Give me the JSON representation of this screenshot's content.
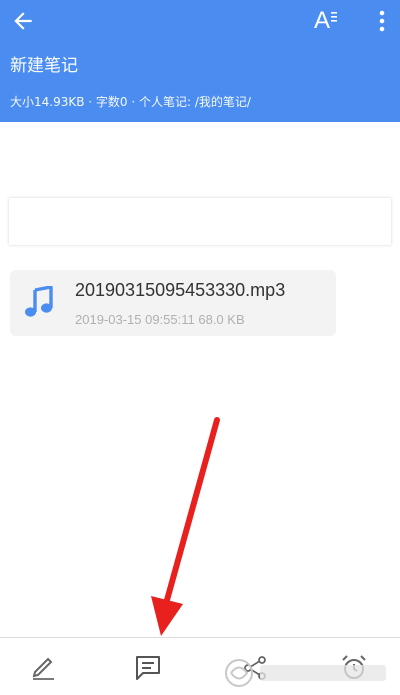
{
  "header": {
    "title": "新建笔记",
    "meta": "大小14.93KB · 字数0 · 个人笔记: /我的笔记/",
    "font_glyph": "A",
    "back_icon": "arrow-left-icon",
    "more_icon": "more-vertical-icon"
  },
  "attachment": {
    "filename": "20190315095453330.mp3",
    "info": "2019-03-15 09:55:11   68.0 KB",
    "icon": "music-note-icon",
    "icon_color": "#4a8cf0"
  },
  "bottom_bar": {
    "icons": [
      "pencil-icon",
      "comment-icon",
      "share-icon",
      "alarm-icon"
    ]
  },
  "colors": {
    "header": "#4a8cf0",
    "annotation_arrow": "#e8201e"
  }
}
